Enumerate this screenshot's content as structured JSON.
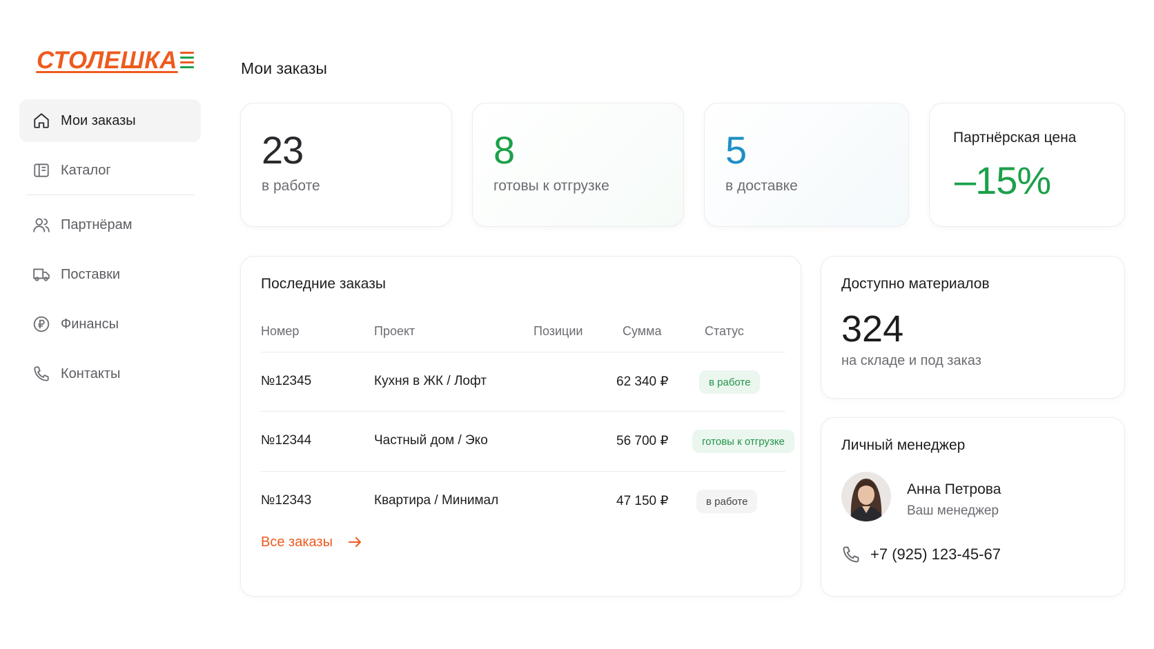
{
  "brand": {
    "name": "СТОЛЕШКА",
    "color": "#ee5a1e",
    "bar_colors": [
      "#ee5a1e",
      "#1ca04a",
      "#ee5a1e",
      "#1ca04a",
      "#ee5a1e"
    ]
  },
  "sidebar": {
    "items": [
      {
        "label": "Мои заказы",
        "icon": "home-icon",
        "active": true
      },
      {
        "label": "Каталог",
        "icon": "catalog-icon",
        "active": false
      },
      {
        "label": "Партнёрам",
        "icon": "partners-icon",
        "active": false
      },
      {
        "label": "Поставки",
        "icon": "truck-icon",
        "active": false
      },
      {
        "label": "Финансы",
        "icon": "ruble-icon",
        "active": false
      },
      {
        "label": "Контакты",
        "icon": "phone-icon",
        "active": false
      }
    ]
  },
  "page": {
    "title": "Мои заказы"
  },
  "stats": [
    {
      "value": "23",
      "label": "в работе",
      "color": "#2a2a2e"
    },
    {
      "value": "8",
      "label": "готовы к отгрузке",
      "color": "#1ca04a"
    },
    {
      "value": "5",
      "label": "в доставке",
      "color": "#1d8fc4"
    }
  ],
  "partner_price": {
    "title": "Партнёрская цена",
    "value": "–15%",
    "color": "#1ca04a"
  },
  "orders": {
    "title": "Последние заказы",
    "columns": [
      "Номер",
      "Проект",
      "Позиции",
      "Сумма",
      "Статус"
    ],
    "rows": [
      {
        "number": "№12345",
        "project": "Кухня в ЖК / Лофт",
        "sum": "62 340 ₽",
        "status": "в работе",
        "status_style": "green"
      },
      {
        "number": "№12344",
        "project": "Частный дом / Эко",
        "sum": "56 700 ₽",
        "status": "готовы к отгрузке",
        "status_style": "green"
      },
      {
        "number": "№12343",
        "project": "Квартира / Минимал",
        "sum": "47 150 ₽",
        "status": "в работе",
        "status_style": "gray"
      }
    ],
    "all_link": "Все заказы"
  },
  "materials": {
    "title": "Доступно материалов",
    "value": "324",
    "label": "на складе и под заказ"
  },
  "manager": {
    "title": "Личный менеджер",
    "name": "Анна Петрова",
    "role": "Ваш менеджер",
    "phone": "+7 (925) 123-45-67"
  }
}
